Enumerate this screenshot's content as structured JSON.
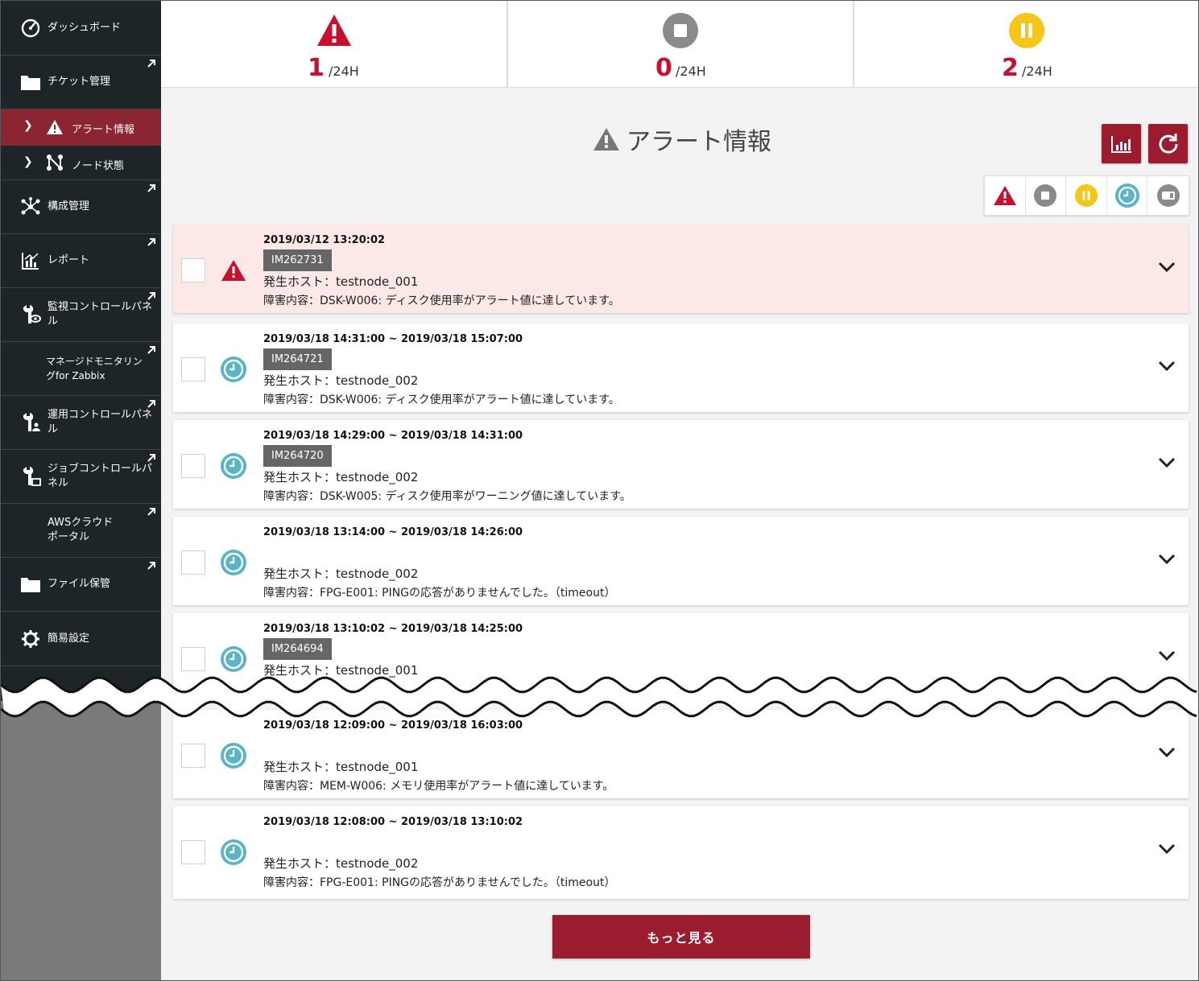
{
  "sidebar": {
    "items": [
      {
        "label": "ダッシュボード",
        "icon": "dashboard-icon"
      },
      {
        "label": "チケット管理",
        "icon": "folder-icon"
      },
      {
        "label": "構成管理",
        "icon": "network-icon"
      },
      {
        "label": "レポート",
        "icon": "report-chart-icon"
      },
      {
        "label": "監視コントロールパネル",
        "icon": "monitor-wrench-icon"
      },
      {
        "label": "マネージドモニタリングfor Zabbix",
        "icon": ""
      },
      {
        "label": "運用コントロールパネル",
        "icon": "ops-wrench-icon"
      },
      {
        "label": "ジョブコントロールパネル",
        "icon": "job-wrench-icon"
      },
      {
        "label": "AWSクラウドポータル",
        "icon": ""
      },
      {
        "label": "ファイル保管",
        "icon": "folder-icon"
      },
      {
        "label": "簡易設定",
        "icon": "gear-icon"
      }
    ],
    "sub_items": [
      {
        "label": "アラート情報",
        "icon": "warning-icon"
      },
      {
        "label": "ノード状態",
        "icon": "node-icon"
      }
    ]
  },
  "stats": [
    {
      "value": "1",
      "suffix": "/24H",
      "icon": "alert-triangle-icon",
      "color": "#c8102e"
    },
    {
      "value": "0",
      "suffix": "/24H",
      "icon": "stop-icon",
      "color": "#8a8a8a"
    },
    {
      "value": "2",
      "suffix": "/24H",
      "icon": "pause-icon",
      "color": "#f5c518"
    }
  ],
  "page_title": "アラート情報",
  "colors": {
    "accent": "#9b1c2e",
    "alert_red": "#c8102e",
    "sidebar_bg": "#1e2529",
    "active_bg": "#8b2532",
    "clock_blue": "#5ab4c8"
  },
  "alerts": [
    {
      "date": "2019/03/12 13:20:02",
      "im": "IM262731",
      "host": "発生ホスト：testnode_001",
      "desc": "障害内容：DSK-W006: ディスク使用率がアラート値に達しています。",
      "status": "alert"
    },
    {
      "date": "2019/03/18 14:31:00 ~ 2019/03/18 15:07:00",
      "im": "IM264721",
      "host": "発生ホスト：testnode_002",
      "desc": "障害内容：DSK-W006: ディスク使用率がアラート値に達しています。",
      "status": "recovered"
    },
    {
      "date": "2019/03/18 14:29:00 ~ 2019/03/18 14:31:00",
      "im": "IM264720",
      "host": "発生ホスト：testnode_002",
      "desc": "障害内容：DSK-W005: ディスク使用率がワーニング値に達しています。",
      "status": "recovered"
    },
    {
      "date": "2019/03/18 13:14:00 ~ 2019/03/18 14:26:00",
      "im": "",
      "host": "発生ホスト：testnode_002",
      "desc": "障害内容：FPG-E001: PINGの応答がありませんでした。（timeout）",
      "status": "recovered"
    },
    {
      "date": "2019/03/18 13:10:02 ~ 2019/03/18 14:25:00",
      "im": "IM264694",
      "host": "発生ホスト：testnode_001",
      "desc": "",
      "status": "recovered"
    },
    {
      "date": "2019/03/18 12:09:00 ~ 2019/03/18 16:03:00",
      "im": "",
      "host": "発生ホスト：testnode_001",
      "desc": "障害内容：MEM-W006: メモリ使用率がアラート値に達しています。",
      "status": "recovered"
    },
    {
      "date": "2019/03/18 12:08:00 ~ 2019/03/18 13:10:02",
      "im": "",
      "host": "発生ホスト：testnode_002",
      "desc": "障害内容：FPG-E001: PINGの応答がありませんでした。（timeout）",
      "status": "recovered"
    }
  ],
  "more_button": "もっと見る"
}
